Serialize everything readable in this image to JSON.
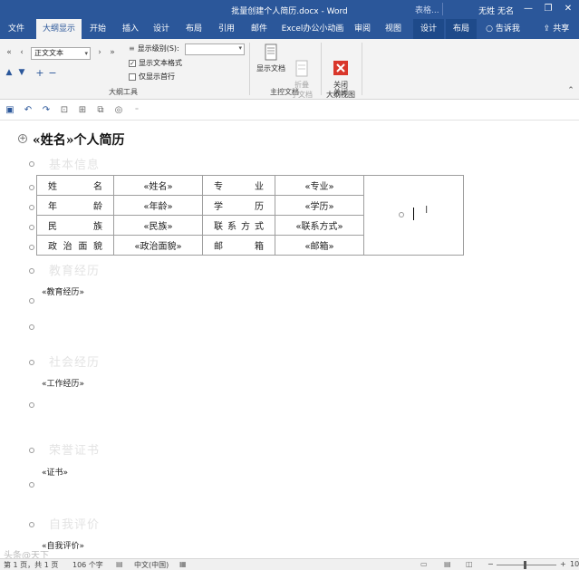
{
  "window": {
    "title": "批量创建个人简历.docx - Word",
    "search_hint": "表格...",
    "user": "无姓 无名",
    "buttons": [
      "—",
      "❐",
      "✕"
    ]
  },
  "tabs": [
    {
      "label": "文件"
    },
    {
      "label": "大纲显示",
      "active": true
    },
    {
      "label": "开始"
    },
    {
      "label": "插入"
    },
    {
      "label": "设计"
    },
    {
      "label": "布局"
    },
    {
      "label": "引用"
    },
    {
      "label": "邮件"
    },
    {
      "label": "Excel办公小动画"
    },
    {
      "label": "审阅"
    },
    {
      "label": "视图"
    },
    {
      "label": "设计",
      "context": true
    },
    {
      "label": "布局",
      "context": true
    },
    {
      "label": "告诉我"
    },
    {
      "label": "共享"
    }
  ],
  "ribbon": {
    "outline_tools": {
      "level_value": "正文文本",
      "show_level_label": "显示级别(S):",
      "show_text_format_label": "显示文本格式",
      "show_text_format_checked": true,
      "first_line_only_label": "仅显示首行",
      "first_line_only_checked": false,
      "group_label": "大纲工具"
    },
    "master_document": {
      "show_doc_label": "显示文档",
      "collapse_label": "折叠\n子文档",
      "group_label": "主控文档"
    },
    "close": {
      "close_label": "关闭\n大纲视图",
      "group_label": "关闭"
    }
  },
  "document": {
    "heading": "«姓名»个人简历",
    "sections": [
      {
        "title": "基本信息"
      },
      {
        "title": "教育经历",
        "field": "«教育经历»"
      },
      {
        "title": "社会经历",
        "field": "«工作经历»"
      },
      {
        "title": "荣誉证书",
        "field": "«证书»"
      },
      {
        "title": "自我评价",
        "field": "«自我评价»"
      }
    ],
    "table": [
      [
        "姓　名",
        "«姓名»",
        "专　业",
        "«专业»"
      ],
      [
        "年　龄",
        "«年龄»",
        "学　历",
        "«学历»"
      ],
      [
        "民　族",
        "«民族»",
        "联系方式",
        "«联系方式»"
      ],
      [
        "政治面貌",
        "«政治面貌»",
        "邮　箱",
        "«邮箱»"
      ]
    ]
  },
  "watermark": "头条@天下",
  "status": {
    "page": "第 1 页，共 1 页",
    "words": "106 个字",
    "language": "中文(中国)",
    "zoom": "10"
  },
  "colors": {
    "brand": "#2b579a",
    "close_red": "#d9372b"
  }
}
